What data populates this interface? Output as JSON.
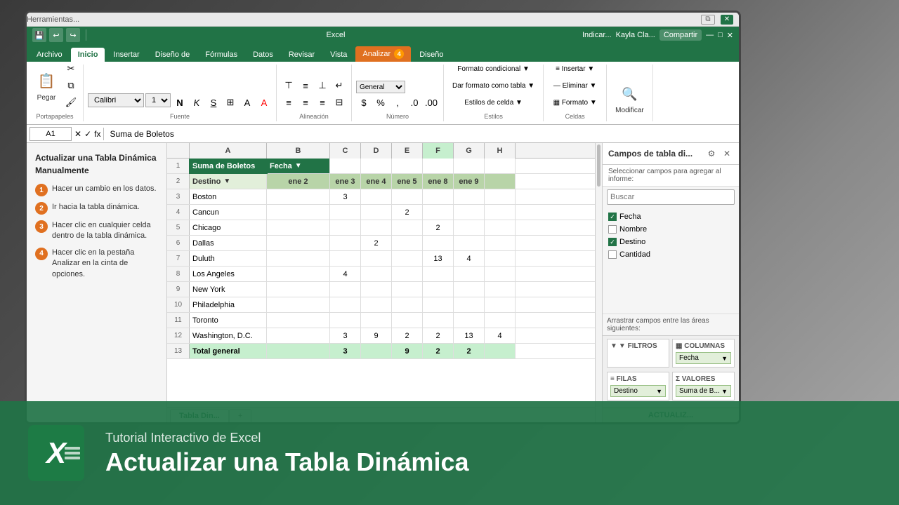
{
  "window": {
    "title": "Herramientas...",
    "herramientas": "Herramientas...",
    "titlebar_controls": [
      "—",
      "□",
      "✕"
    ]
  },
  "ribbon": {
    "tabs": [
      {
        "label": "Archivo",
        "active": false
      },
      {
        "label": "Inicio",
        "active": true
      },
      {
        "label": "Insertar",
        "active": false
      },
      {
        "label": "Diseño de",
        "active": false
      },
      {
        "label": "Fórmulas",
        "active": false
      },
      {
        "label": "Datos",
        "active": false
      },
      {
        "label": "Revisar",
        "active": false
      },
      {
        "label": "Vista",
        "active": false
      },
      {
        "label": "Analizar",
        "active": false,
        "highlighted": true
      },
      {
        "label": "Diseño",
        "active": false
      }
    ],
    "user": "Kayla Cla...",
    "share": "Compartir",
    "indicate": "Indicar..."
  },
  "formula_bar": {
    "cell_ref": "A1",
    "formula": "Suma de Boletos"
  },
  "left_panel": {
    "title": "Actualizar una Tabla Dinámica Manualmente",
    "steps": [
      {
        "num": "1",
        "text": "Hacer un cambio en los datos."
      },
      {
        "num": "2",
        "text": "Ir hacia la tabla dinámica."
      },
      {
        "num": "3",
        "text": "Hacer clic en cualquier celda dentro de la tabla dinámica."
      },
      {
        "num": "4",
        "text": "Hacer clic en la pestaña Analizar en la cinta de opciones."
      }
    ]
  },
  "spreadsheet": {
    "column_headers": [
      "A",
      "B",
      "C",
      "D",
      "E",
      "F",
      "G",
      "H"
    ],
    "rows": [
      {
        "num": "1",
        "a": "Suma de Boletos",
        "b": "Fecha ▼",
        "c": "",
        "d": "",
        "e": "",
        "f": "",
        "g": "",
        "h": ""
      },
      {
        "num": "2",
        "a": "Destino ▼",
        "b": "ene 2",
        "c": "ene 3",
        "d": "ene 4",
        "e": "ene 5",
        "f": "ene 8",
        "g": "ene 9",
        "h": ""
      },
      {
        "num": "3",
        "a": "Boston",
        "b": "",
        "c": "3",
        "d": "",
        "e": "",
        "f": "",
        "g": "",
        "h": ""
      },
      {
        "num": "4",
        "a": "Cancun",
        "b": "",
        "c": "",
        "d": "",
        "e": "2",
        "f": "",
        "g": "",
        "h": ""
      },
      {
        "num": "5",
        "a": "Chicago",
        "b": "",
        "c": "",
        "d": "",
        "e": "",
        "f": "2",
        "g": "",
        "h": ""
      },
      {
        "num": "6",
        "a": "Dallas",
        "b": "",
        "c": "",
        "d": "2",
        "e": "",
        "f": "",
        "g": "",
        "h": ""
      },
      {
        "num": "7",
        "a": "Duluth",
        "b": "",
        "c": "",
        "d": "",
        "e": "",
        "f": "13",
        "g": "4",
        "h": ""
      },
      {
        "num": "8",
        "a": "Los Angeles",
        "b": "",
        "c": "4",
        "d": "",
        "e": "",
        "f": "",
        "g": "",
        "h": ""
      },
      {
        "num": "9",
        "a": "New York",
        "b": "",
        "c": "",
        "d": "",
        "e": "",
        "f": "",
        "g": "",
        "h": ""
      },
      {
        "num": "10",
        "a": "Philadelphia",
        "b": "",
        "c": "",
        "d": "",
        "e": "",
        "f": "",
        "g": "",
        "h": ""
      },
      {
        "num": "11",
        "a": "Toronto",
        "b": "",
        "c": "",
        "d": "",
        "e": "",
        "f": "",
        "g": "",
        "h": ""
      },
      {
        "num": "12",
        "a": "Washington, D.C.",
        "b": "",
        "c": "3",
        "d": "9",
        "e": "2",
        "f": "2",
        "g": "13",
        "h": "4"
      },
      {
        "num": "13",
        "a": "Total general",
        "b": "",
        "c": "3",
        "d": "",
        "e": "9",
        "f": "2",
        "g": "2",
        "h": ""
      }
    ],
    "sheet_tabs": [
      "Tabla Din..."
    ]
  },
  "right_panel": {
    "title": "Campos de tabla di...",
    "subtitle": "Seleccionar campos para agregar al informe:",
    "search_placeholder": "Buscar",
    "fields": [
      {
        "label": "Fecha",
        "checked": true
      },
      {
        "label": "Nombre",
        "checked": false
      },
      {
        "label": "Destino",
        "checked": true
      },
      {
        "label": "Cantidad",
        "checked": false
      }
    ],
    "drag_hint": "Arrastrar campos entre las áreas siguientes:",
    "areas": {
      "filters_label": "▼ FILTROS",
      "columns_label": "▦ COLUMNAS",
      "columns_item": "Fecha",
      "rows_label": "≡ FILAS",
      "rows_item": "Destino",
      "values_label": "Σ VALORES",
      "values_item": "Suma de B..."
    },
    "actualizar": "ACTUALIZ..."
  },
  "bottom_bar": {
    "logo_letter": "X",
    "subtitle": "Tutorial Interactivo de Excel",
    "title": "Actualizar una Tabla Dinámica"
  }
}
